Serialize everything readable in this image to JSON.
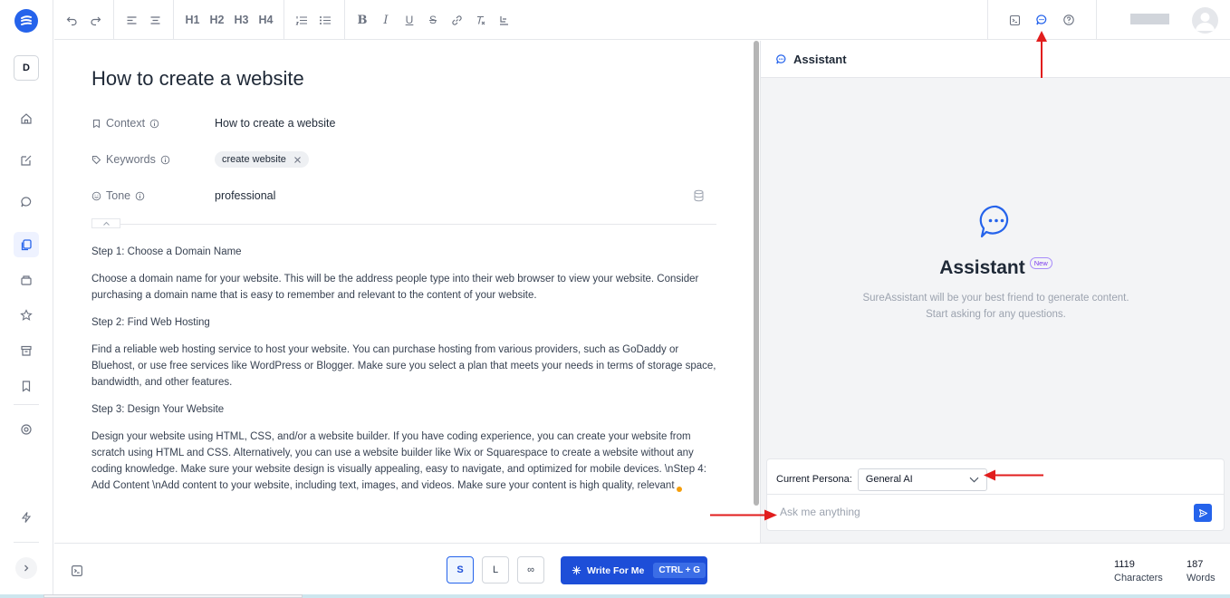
{
  "app": {
    "brand_color": "#2563eb"
  },
  "sidebar": {
    "workspace_initial": "D",
    "items": [
      {
        "name": "home-icon"
      },
      {
        "name": "edit-icon"
      },
      {
        "name": "chat-icon"
      },
      {
        "name": "documents-icon",
        "active": true
      },
      {
        "name": "templates-icon"
      },
      {
        "name": "star-icon"
      },
      {
        "name": "archive-icon"
      },
      {
        "name": "bookmark-icon"
      },
      {
        "name": "help-circle-icon"
      },
      {
        "name": "lightning-icon"
      }
    ]
  },
  "toolbar": {
    "headings": [
      "H1",
      "H2",
      "H3",
      "H4"
    ],
    "bold": "B",
    "italic": "I",
    "underline": "U",
    "strike": "S"
  },
  "document": {
    "title": "How to create a website",
    "context_label": "Context",
    "context_value": "How to create a website",
    "keywords_label": "Keywords",
    "keywords": [
      "create website"
    ],
    "tone_label": "Tone",
    "tone_value": "professional",
    "paragraphs": [
      "Step 1: Choose a Domain Name",
      "Choose a domain name for your website. This will be the address people type into their web browser to view your website. Consider purchasing a domain name that is easy to remember and relevant to the content of your website.",
      "Step 2: Find Web Hosting",
      "Find a reliable web hosting service to host your website. You can purchase hosting from various providers, such as GoDaddy or Bluehost, or use free services like WordPress or Blogger. Make sure you select a plan that meets your needs in terms of storage space, bandwidth, and other features.",
      "Step 3: Design Your Website",
      "Design your website using HTML, CSS, and/or a website builder. If you have coding experience, you can create your website from scratch using HTML and CSS. Alternatively, you can use a website builder like Wix or Squarespace to create a website without any coding knowledge. Make sure your website design is visually appealing, easy to navigate, and optimized for mobile devices. \\nStep 4: Add Content \\nAdd content to your website, including text, images, and videos. Make sure your content is high quality, relevant"
    ]
  },
  "assistant": {
    "header_title": "Assistant",
    "title": "Assistant",
    "badge": "New",
    "description": "SureAssistant will be your best friend to generate content. Start asking for any questions.",
    "persona_label": "Current Persona:",
    "persona_value": "General AI",
    "input_placeholder": "Ask me anything"
  },
  "footer": {
    "length_options": [
      "S",
      "L",
      "∞"
    ],
    "selected_length": "S",
    "write_label": "Write For Me",
    "write_shortcut": "CTRL + G",
    "characters_count": "1119",
    "characters_label": "Characters",
    "words_count": "187",
    "words_label": "Words"
  },
  "annotations": {
    "arrow_color": "#e11d1d"
  }
}
